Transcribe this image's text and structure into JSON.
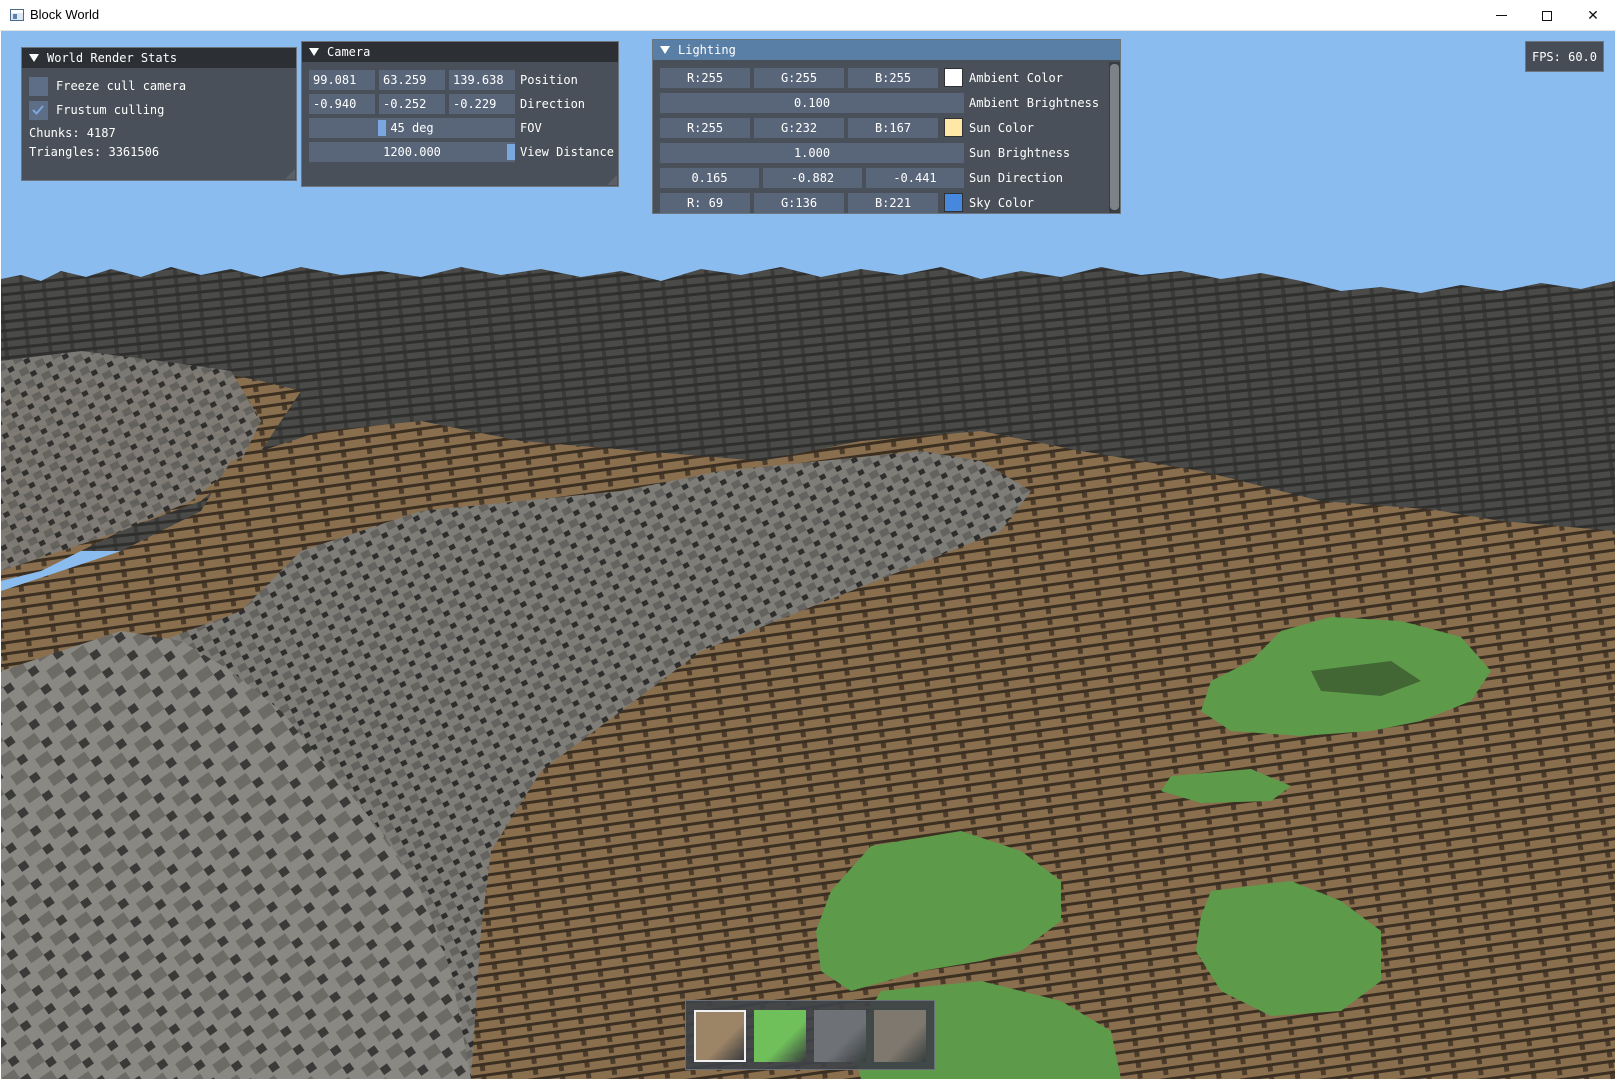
{
  "window": {
    "title": "Block World"
  },
  "colors": {
    "sky": "#8bbcef",
    "panel_bg": "#44484e",
    "panel_header": "#2c2f33",
    "panel_header_active": "#5a7fa6",
    "field_bg": "#59667a",
    "slider_grab": "#7aa7dd"
  },
  "render_stats": {
    "title": "World Render Stats",
    "freeze_cull_label": "Freeze cull camera",
    "freeze_cull_checked": false,
    "frustum_culling_label": "Frustum culling",
    "frustum_culling_checked": true,
    "chunks_text": "Chunks: 4187",
    "triangles_text": "Triangles: 3361506"
  },
  "camera": {
    "title": "Camera",
    "position_label": "Position",
    "position": [
      "99.081",
      "63.259",
      "139.638"
    ],
    "direction_label": "Direction",
    "direction": [
      "-0.940",
      "-0.252",
      "-0.229"
    ],
    "fov_label": "FOV",
    "fov_value": "45 deg",
    "fov_fraction": 0.35,
    "view_distance_label": "View Distance",
    "view_distance_value": "1200.000",
    "view_distance_fraction": 1.0
  },
  "lighting": {
    "title": "Lighting",
    "ambient_color_label": "Ambient Color",
    "ambient_color": [
      "R:255",
      "G:255",
      "B:255"
    ],
    "ambient_color_hex": "#ffffff",
    "ambient_brightness_label": "Ambient Brightness",
    "ambient_brightness": "0.100",
    "sun_color_label": "Sun Color",
    "sun_color": [
      "R:255",
      "G:232",
      "B:167"
    ],
    "sun_color_hex": "#ffe8a7",
    "sun_brightness_label": "Sun Brightness",
    "sun_brightness": "1.000",
    "sun_direction_label": "Sun Direction",
    "sun_direction": [
      "0.165",
      "-0.882",
      "-0.441"
    ],
    "sky_color_label": "Sky Color",
    "sky_color": [
      "R: 69",
      "G:136",
      "B:221"
    ],
    "sky_color_hex": "#4588dd"
  },
  "fps": {
    "text": "FPS: 60.0"
  },
  "hotbar": {
    "selected_index": 0,
    "slots": [
      {
        "name": "dirt-block-slot",
        "color": "#9c8466"
      },
      {
        "name": "grass-block-slot",
        "color": "#6fbf5a"
      },
      {
        "name": "stone-block-slot",
        "color": "#6e7176"
      },
      {
        "name": "gravel-block-slot",
        "color": "#7f786e"
      }
    ]
  }
}
